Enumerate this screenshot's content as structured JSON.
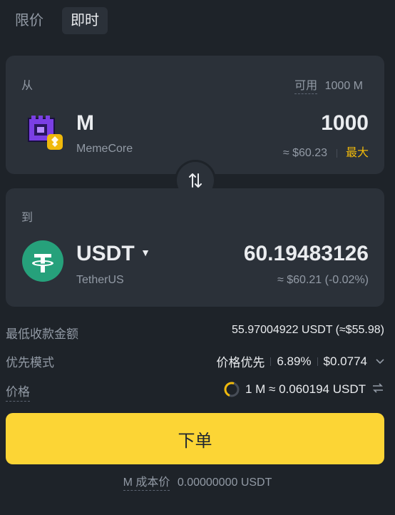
{
  "tabs": [
    {
      "label": "限价"
    },
    {
      "label": "即时"
    }
  ],
  "from": {
    "label": "从",
    "available_label": "可用",
    "available_value": "1000 M",
    "symbol": "M",
    "name": "MemeCore",
    "amount": "1000",
    "usd": "≈ $60.23",
    "max_label": "最大"
  },
  "to": {
    "label": "到",
    "symbol": "USDT",
    "name": "TetherUS",
    "amount": "60.19483126",
    "usd": "≈ $60.21 (-0.02%)"
  },
  "details": {
    "min_receive_label": "最低收款金额",
    "min_receive_value": "55.97004922 USDT (≈$55.98)",
    "priority_label": "优先模式",
    "priority_mode": "价格优先",
    "priority_pct": "6.89%",
    "priority_fee": "$0.0774",
    "price_label": "价格",
    "price_value": "1 M ≈ 0.060194 USDT"
  },
  "submit_label": "下单",
  "cost": {
    "label": "M 成本价",
    "value": "0.00000000 USDT"
  },
  "colors": {
    "background": "#1e2329",
    "card": "#2b3139",
    "accent": "#fcd535",
    "tether": "#26a17b",
    "memecore": "#7b3fe4"
  },
  "icons": {
    "from_coin": "memecore-logo",
    "from_chain": "bnb-chain-badge",
    "to_coin": "tether-logo",
    "swap": "swap-arrows-icon"
  }
}
